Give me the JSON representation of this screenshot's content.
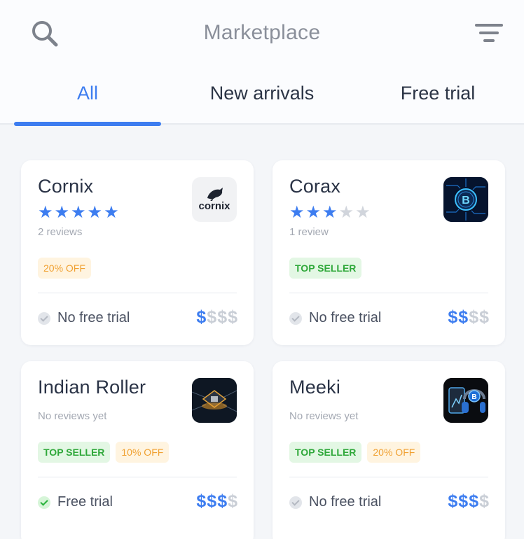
{
  "header": {
    "title": "Marketplace",
    "search_icon": "search-icon",
    "filter_icon": "filter-icon"
  },
  "tabs": [
    {
      "label": "All",
      "active": true
    },
    {
      "label": "New arrivals",
      "active": false
    },
    {
      "label": "Free trial",
      "active": false
    }
  ],
  "colors": {
    "accent": "#3d7df0",
    "top_seller_bg": "#e3f7e4",
    "top_seller_text": "#2fa83a",
    "discount_bg": "#fff4e0",
    "discount_text": "#f0a030"
  },
  "products": [
    {
      "name": "Cornix",
      "rating": 5,
      "max_rating": 5,
      "reviews": "2 reviews",
      "badges": [
        "20% OFF"
      ],
      "trial": "No free trial",
      "free_trial": false,
      "price_level": 1,
      "price_max": 4,
      "logo": "cornix-logo",
      "logo_text": "cornix"
    },
    {
      "name": "Corax",
      "rating": 3,
      "max_rating": 5,
      "reviews": "1 review",
      "badges": [
        "TOP SELLER"
      ],
      "trial": "No free trial",
      "free_trial": false,
      "price_level": 2,
      "price_max": 4,
      "logo": "bitcoin-circuit-logo"
    },
    {
      "name": "Indian Roller",
      "rating": 0,
      "max_rating": 5,
      "reviews": "No reviews yet",
      "badges": [
        "TOP SELLER",
        "10% OFF"
      ],
      "trial": "Free trial",
      "free_trial": true,
      "price_level": 3,
      "price_max": 4,
      "logo": "chip-logo"
    },
    {
      "name": "Meeki",
      "rating": 0,
      "max_rating": 5,
      "reviews": "No reviews yet",
      "badges": [
        "TOP SELLER",
        "20% OFF"
      ],
      "trial": "No free trial",
      "free_trial": false,
      "price_level": 3,
      "price_max": 4,
      "logo": "crypto-headphones-logo"
    }
  ]
}
